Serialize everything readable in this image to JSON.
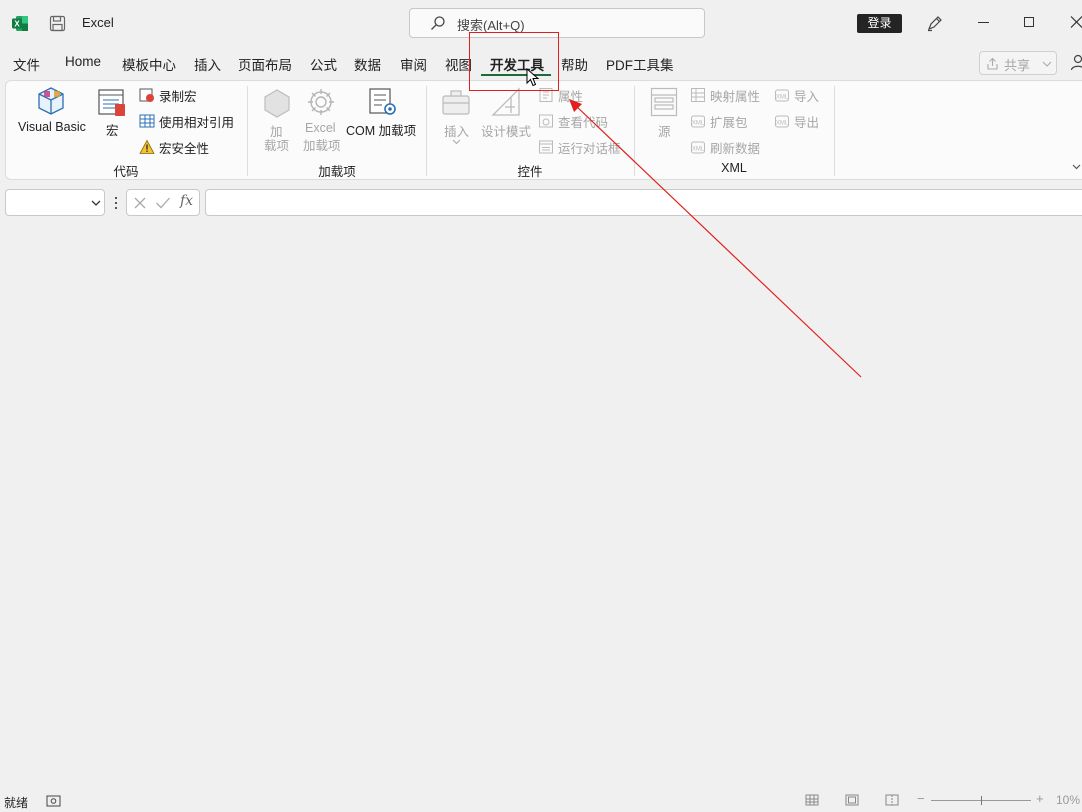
{
  "titlebar": {
    "app_title": "Excel",
    "search_placeholder": "搜索(Alt+Q)",
    "login_label": "登录",
    "window_controls": [
      "minimize-icon",
      "maximize-icon",
      "close-icon"
    ]
  },
  "tabs": [
    {
      "label": "文件"
    },
    {
      "label": "Home"
    },
    {
      "label": "模板中心"
    },
    {
      "label": "插入"
    },
    {
      "label": "页面布局"
    },
    {
      "label": "公式"
    },
    {
      "label": "数据"
    },
    {
      "label": "审阅"
    },
    {
      "label": "视图"
    },
    {
      "label": "开发工具",
      "active": true
    },
    {
      "label": "帮助"
    },
    {
      "label": "PDF工具集"
    }
  ],
  "share_label": "共享",
  "ribbon": {
    "code": {
      "label": "代码",
      "visual_basic": "Visual Basic",
      "macros": "宏",
      "record_macro": "录制宏",
      "relative_refs": "使用相对引用",
      "macro_security": "宏安全性"
    },
    "addins": {
      "label": "加载项",
      "addins_line1": "加",
      "addins_line2": "载项",
      "excel_addins_line1": "Excel",
      "excel_addins_line2": "加载项",
      "com_addins": "COM 加载项"
    },
    "controls": {
      "label": "控件",
      "insert": "插入",
      "design_mode": "设计模式",
      "properties": "属性",
      "view_code": "查看代码",
      "run_dialog": "运行对话框"
    },
    "xml": {
      "label": "XML",
      "source": "源",
      "map_properties": "映射属性",
      "expansion_packs": "扩展包",
      "refresh_data": "刷新数据",
      "import": "导入",
      "export": "导出"
    }
  },
  "formula_bar": {
    "fx_label": "fx"
  },
  "statusbar": {
    "ready": "就绪",
    "zoom": "10%",
    "zoom_minus": "−",
    "zoom_plus": "+"
  },
  "colors": {
    "accent_green": "#1d6b3b",
    "annotation_red": "#e0201c",
    "excel_green": "#107c41"
  }
}
